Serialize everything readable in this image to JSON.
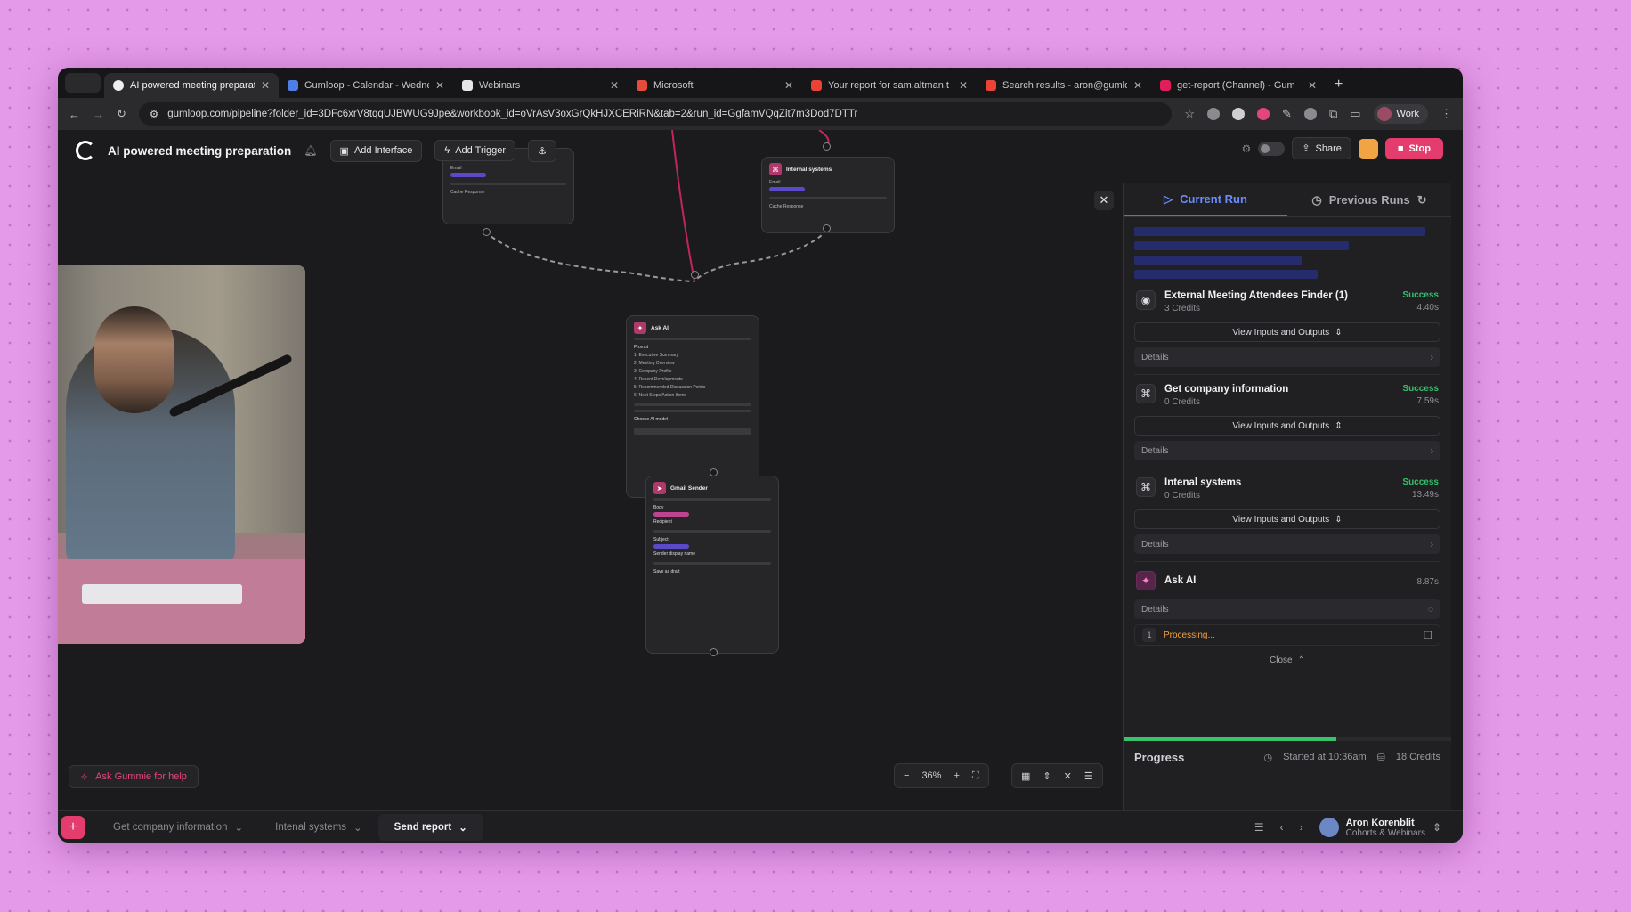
{
  "browser": {
    "tabs": [
      {
        "label": "AI powered meeting preparati",
        "active": true
      },
      {
        "label": "Gumloop - Calendar - Wedne",
        "active": false
      },
      {
        "label": "Webinars",
        "active": false
      },
      {
        "label": "Microsoft",
        "active": false
      },
      {
        "label": "Your report for sam.altman.t",
        "active": false
      },
      {
        "label": "Search results - aron@gumlo",
        "active": false
      },
      {
        "label": "get-report (Channel) - Gum",
        "active": false
      }
    ],
    "url": "gumloop.com/pipeline?folder_id=3DFc6xrV8tqqUJBWUG9Jpe&workbook_id=oVrAsV3oxGrQkHJXCERiRN&tab=2&run_id=GgfamVQqZit7m3Dod7DTTr",
    "profile_label": "Work"
  },
  "header": {
    "title": "AI powered meeting preparation",
    "add_interface": "Add Interface",
    "add_trigger": "Add Trigger",
    "share": "Share",
    "stop": "Stop"
  },
  "canvas_nodes": {
    "ask_ai": {
      "title": "Ask AI",
      "prompt_label": "Prompt",
      "items": [
        "1. Executive Summary",
        "2. Meeting Overview",
        "3. Company Profile",
        "4. Recent Developments",
        "5. Recommended Discussion Points",
        "6. Next Steps/Action Items"
      ],
      "model_label": "Choose AI model"
    },
    "gmail": {
      "title": "Gmail Sender",
      "body_label": "Body",
      "recipient_label": "Recipient",
      "subject_label": "Subject",
      "sender_label": "Sender display name",
      "draft_label": "Save as draft"
    },
    "internal_top": {
      "title": "Internal systems",
      "email_label": "Email",
      "cache_label": "Cache Response"
    },
    "left_top": {
      "email_label": "Email",
      "cache_label": "Cache Response"
    }
  },
  "panel": {
    "tab_current": "Current Run",
    "tab_previous": "Previous Runs",
    "steps": [
      {
        "name": "External Meeting Attendees Finder (1)",
        "credits": "3 Credits",
        "status": "Success",
        "time": "4.40s",
        "io_label": "View Inputs and Outputs",
        "details": "Details",
        "icon": "person-search-icon"
      },
      {
        "name": "Get company information",
        "credits": "0 Credits",
        "status": "Success",
        "time": "7.59s",
        "io_label": "View Inputs and Outputs",
        "details": "Details",
        "icon": "subflow-icon"
      },
      {
        "name": "Intenal systems",
        "credits": "0 Credits",
        "status": "Success",
        "time": "13.49s",
        "io_label": "View Inputs and Outputs",
        "details": "Details",
        "icon": "subflow-icon"
      }
    ],
    "ask_ai": {
      "name": "Ask AI",
      "time": "8.87s",
      "details": "Details",
      "proc_num": "1",
      "processing": "Processing...",
      "close": "Close"
    },
    "progress": {
      "label": "Progress",
      "fraction": 0.65,
      "started": "Started at 10:36am",
      "credits": "18 Credits"
    }
  },
  "zoom": {
    "level": "36%"
  },
  "gummie": "Ask Gummie for help",
  "bottom": {
    "tabs": [
      "Get company information",
      "Intenal systems",
      "Send report"
    ],
    "active_tab": "Send report",
    "user_name": "Aron Korenblit",
    "user_org": "Cohorts & Webinars"
  },
  "colors": {
    "accent_pink": "#e43c6c",
    "success": "#33c06a",
    "processing": "#f0a040",
    "active_tab_blue": "#6c8cff",
    "background": "#e59ae9"
  }
}
